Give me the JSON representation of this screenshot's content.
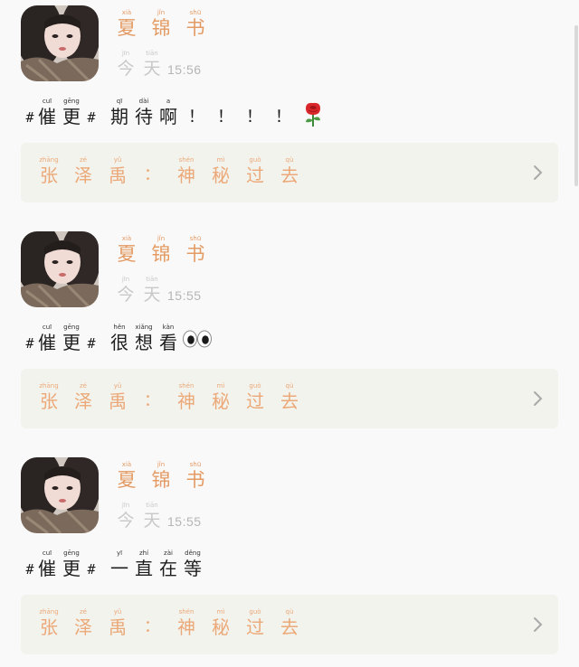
{
  "colors": {
    "accent_name": "#e39a63",
    "card_text": "#eba878",
    "card_bg": "#f3f3ed",
    "muted": "#c8c8c8",
    "body_text": "#1e1e1e"
  },
  "posts": [
    {
      "author": {
        "chars": [
          {
            "py": "xià",
            "ch": "夏"
          },
          {
            "py": "jǐn",
            "ch": "锦"
          },
          {
            "py": "shū",
            "ch": "书"
          }
        ]
      },
      "date": {
        "chars": [
          {
            "py": "jīn",
            "ch": "今"
          },
          {
            "py": "tiān",
            "ch": "天"
          }
        ]
      },
      "time": "15:56",
      "hashtag": {
        "open": "#",
        "close": "#",
        "chars": [
          {
            "py": "cuī",
            "ch": "催"
          },
          {
            "py": "gēng",
            "ch": "更"
          }
        ]
      },
      "text": {
        "chars": [
          {
            "py": "qī",
            "ch": "期"
          },
          {
            "py": "dài",
            "ch": "待"
          },
          {
            "py": "a",
            "ch": "啊"
          }
        ]
      },
      "trailing": [
        "！",
        "！",
        "！",
        "！"
      ],
      "emoji_icon": "rose-icon",
      "link": {
        "chars": [
          {
            "py": "zhāng",
            "ch": "张"
          },
          {
            "py": "zé",
            "ch": "泽"
          },
          {
            "py": "yǔ",
            "ch": "禹"
          },
          {
            "py": "",
            "ch": "："
          },
          {
            "py": "shén",
            "ch": "神"
          },
          {
            "py": "mì",
            "ch": "秘"
          },
          {
            "py": "guò",
            "ch": "过"
          },
          {
            "py": "qù",
            "ch": "去"
          }
        ]
      }
    },
    {
      "author": {
        "chars": [
          {
            "py": "xià",
            "ch": "夏"
          },
          {
            "py": "jǐn",
            "ch": "锦"
          },
          {
            "py": "shū",
            "ch": "书"
          }
        ]
      },
      "date": {
        "chars": [
          {
            "py": "jīn",
            "ch": "今"
          },
          {
            "py": "tiān",
            "ch": "天"
          }
        ]
      },
      "time": "15:55",
      "hashtag": {
        "open": "#",
        "close": "#",
        "chars": [
          {
            "py": "cuī",
            "ch": "催"
          },
          {
            "py": "gēng",
            "ch": "更"
          }
        ]
      },
      "text": {
        "chars": [
          {
            "py": "hěn",
            "ch": "很"
          },
          {
            "py": "xiǎng",
            "ch": "想"
          },
          {
            "py": "kàn",
            "ch": "看"
          }
        ]
      },
      "trailing": [],
      "emoji_icon": "eyes-icon",
      "link": {
        "chars": [
          {
            "py": "zhāng",
            "ch": "张"
          },
          {
            "py": "zé",
            "ch": "泽"
          },
          {
            "py": "yǔ",
            "ch": "禹"
          },
          {
            "py": "",
            "ch": "："
          },
          {
            "py": "shén",
            "ch": "神"
          },
          {
            "py": "mì",
            "ch": "秘"
          },
          {
            "py": "guò",
            "ch": "过"
          },
          {
            "py": "qù",
            "ch": "去"
          }
        ]
      }
    },
    {
      "author": {
        "chars": [
          {
            "py": "xià",
            "ch": "夏"
          },
          {
            "py": "jǐn",
            "ch": "锦"
          },
          {
            "py": "shū",
            "ch": "书"
          }
        ]
      },
      "date": {
        "chars": [
          {
            "py": "jīn",
            "ch": "今"
          },
          {
            "py": "tiān",
            "ch": "天"
          }
        ]
      },
      "time": "15:55",
      "hashtag": {
        "open": "#",
        "close": "#",
        "chars": [
          {
            "py": "cuī",
            "ch": "催"
          },
          {
            "py": "gēng",
            "ch": "更"
          }
        ]
      },
      "text": {
        "chars": [
          {
            "py": "yī",
            "ch": "一"
          },
          {
            "py": "zhí",
            "ch": "直"
          },
          {
            "py": "zài",
            "ch": "在"
          },
          {
            "py": "děng",
            "ch": "等"
          }
        ]
      },
      "trailing": [],
      "emoji_icon": "",
      "link": {
        "chars": [
          {
            "py": "zhāng",
            "ch": "张"
          },
          {
            "py": "zé",
            "ch": "泽"
          },
          {
            "py": "yǔ",
            "ch": "禹"
          },
          {
            "py": "",
            "ch": "："
          },
          {
            "py": "shén",
            "ch": "神"
          },
          {
            "py": "mì",
            "ch": "秘"
          },
          {
            "py": "guò",
            "ch": "过"
          },
          {
            "py": "qù",
            "ch": "去"
          }
        ]
      }
    }
  ]
}
